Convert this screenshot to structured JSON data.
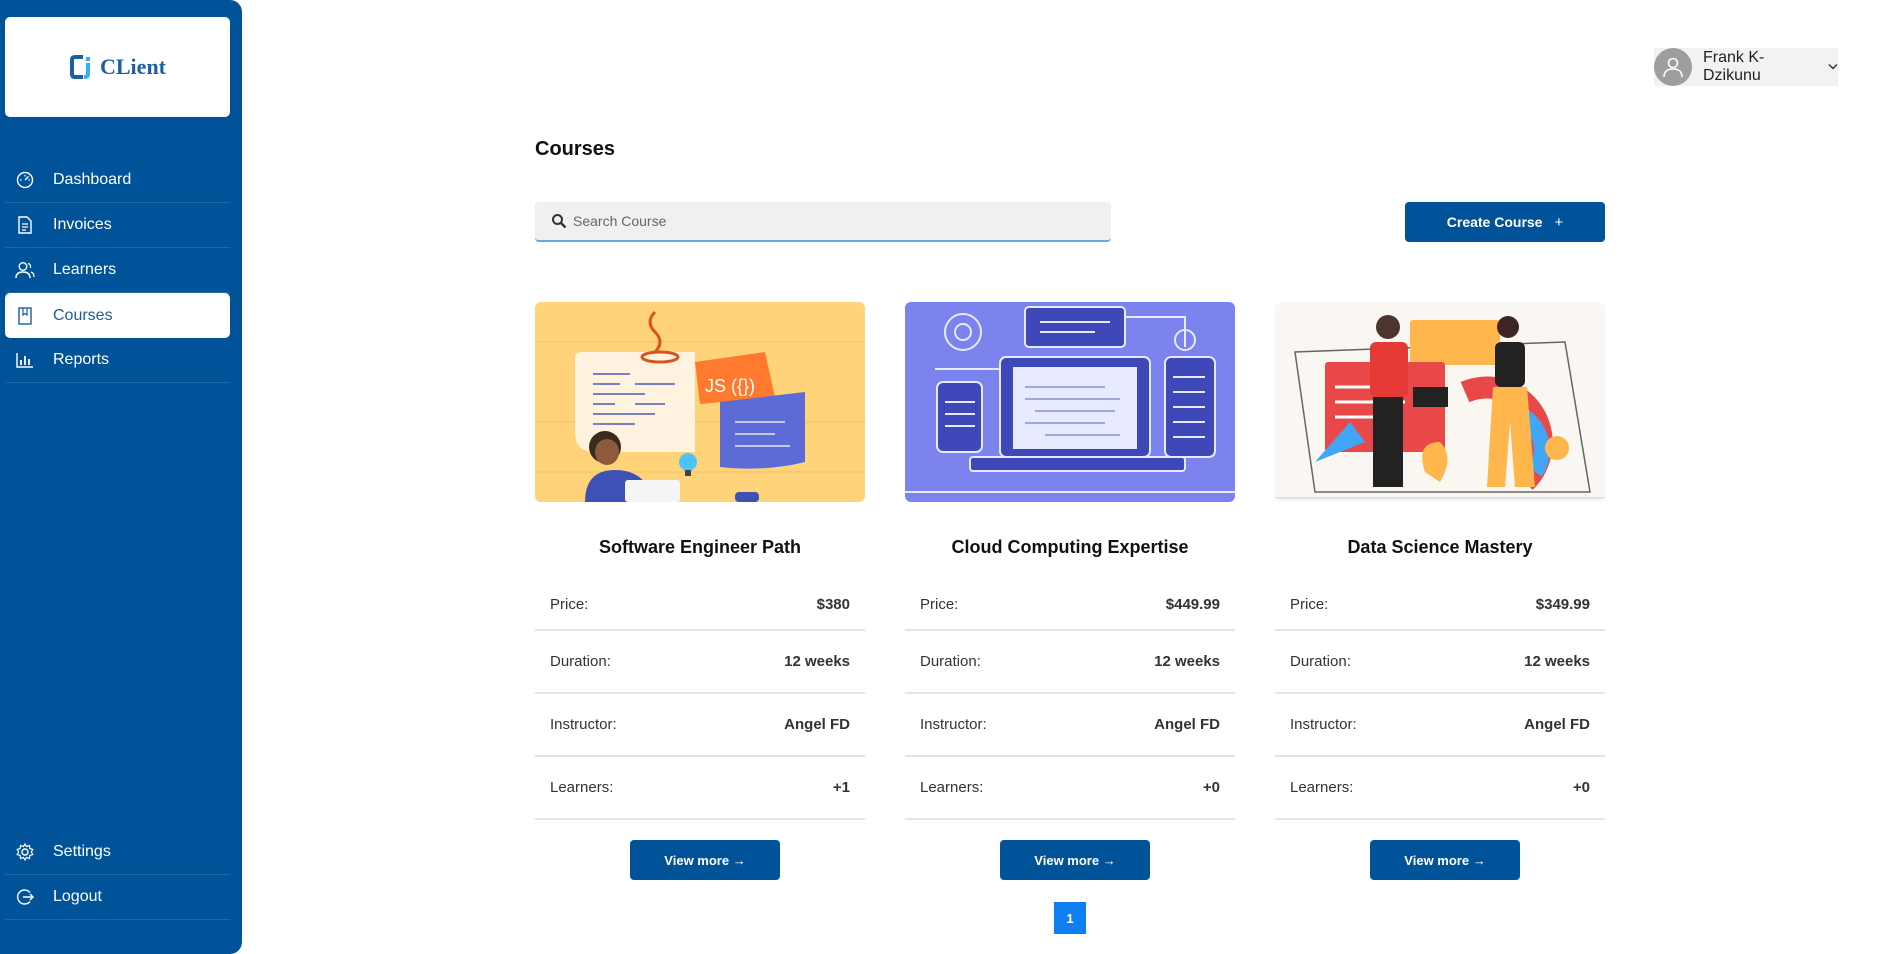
{
  "app": {
    "logo_text": "CLient",
    "logo_mark": "Ci"
  },
  "sidebar": {
    "items": [
      {
        "label": "Dashboard",
        "icon": "dashboard-gauge-icon"
      },
      {
        "label": "Invoices",
        "icon": "document-icon"
      },
      {
        "label": "Learners",
        "icon": "users-icon"
      },
      {
        "label": "Courses",
        "icon": "book-icon",
        "active": true
      },
      {
        "label": "Reports",
        "icon": "bar-chart-icon"
      }
    ],
    "bottom": [
      {
        "label": "Settings",
        "icon": "gear-icon"
      },
      {
        "label": "Logout",
        "icon": "logout-icon"
      }
    ]
  },
  "user": {
    "name": "Frank K-Dzikunu"
  },
  "page": {
    "title": "Courses"
  },
  "search": {
    "placeholder": "Search Course"
  },
  "actions": {
    "create_label": "Create Course",
    "create_icon": "+"
  },
  "courses": [
    {
      "title": "Software Engineer Path",
      "rows": [
        {
          "label": "Price:",
          "value": "$380"
        },
        {
          "label": "Duration:",
          "value": "12 weeks"
        },
        {
          "label": "Instructor:",
          "value": "Angel FD"
        },
        {
          "label": "Learners:",
          "value": "+1"
        }
      ],
      "button": "View more →",
      "image": "software-engineer-illustration",
      "img_text": "JS ({})"
    },
    {
      "title": "Cloud Computing Expertise",
      "rows": [
        {
          "label": "Price:",
          "value": "$449.99"
        },
        {
          "label": "Duration:",
          "value": "12 weeks"
        },
        {
          "label": "Instructor:",
          "value": "Angel FD"
        },
        {
          "label": "Learners:",
          "value": "+0"
        }
      ],
      "button": "View more →",
      "image": "cloud-computing-illustration"
    },
    {
      "title": "Data Science Mastery",
      "rows": [
        {
          "label": "Price:",
          "value": "$349.99"
        },
        {
          "label": "Duration:",
          "value": "12 weeks"
        },
        {
          "label": "Instructor:",
          "value": "Angel FD"
        },
        {
          "label": "Learners:",
          "value": "+0"
        }
      ],
      "button": "View more →",
      "image": "data-science-illustration"
    }
  ],
  "pagination": {
    "current": "1"
  },
  "colors": {
    "primary": "#005399",
    "pager": "#0d7ff0"
  }
}
